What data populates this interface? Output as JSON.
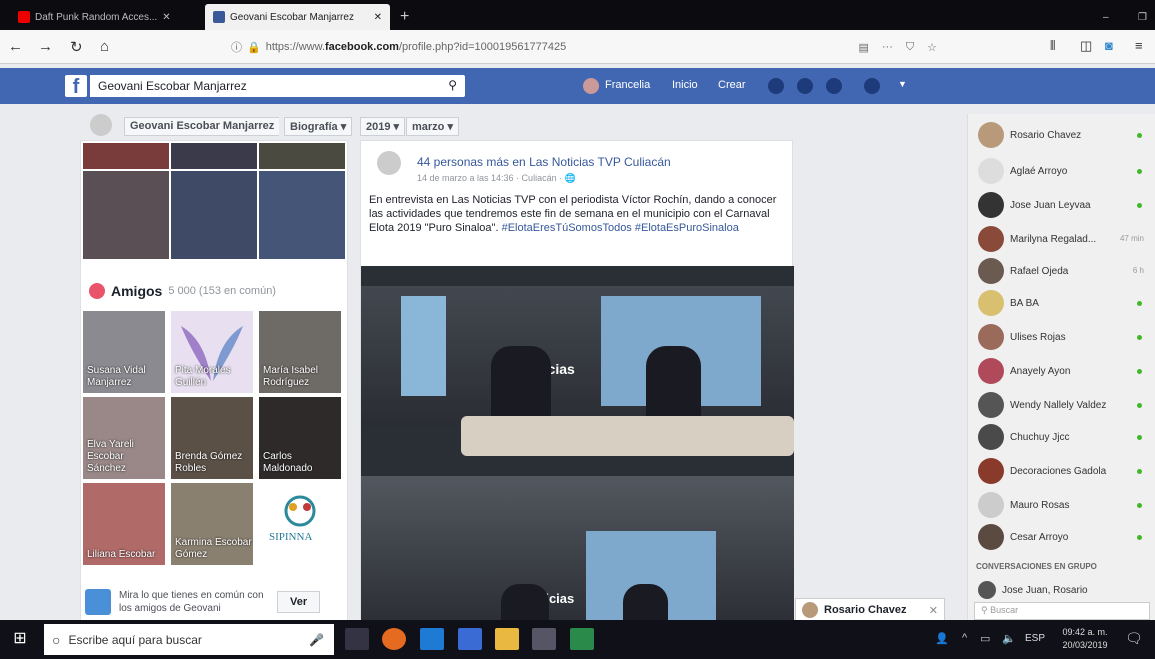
{
  "browser": {
    "tabs": [
      {
        "label": "Daft Punk Random Acces..."
      },
      {
        "label": "Geovani Escobar Manjarrez"
      }
    ],
    "url_prefix": "https://www.",
    "url_domain": "facebook.com",
    "url_path": "/profile.php?id=100019561777425"
  },
  "fb": {
    "search_value": "Geovani Escobar Manjarrez",
    "user_name": "Francelia",
    "nav_home": "Inicio",
    "nav_create": "Crear"
  },
  "timeline": {
    "name": "Geovani Escobar Manjarrez",
    "section": "Biografía",
    "year": "2019",
    "month": "marzo"
  },
  "friends": {
    "title": "Amigos",
    "count": "5 000 (153 en común)",
    "items": [
      {
        "name": "Susana Vidal Manjarrez"
      },
      {
        "name": "Pita Morales Guillén"
      },
      {
        "name": "María Isabel Rodríguez"
      },
      {
        "name": "Elva Yareli Escobar Sánchez"
      },
      {
        "name": "Brenda Gómez Robles"
      },
      {
        "name": "Carlos Maldonado"
      },
      {
        "name": "Liliana Escobar"
      },
      {
        "name": "Karmina Escobar Gómez"
      },
      {
        "name": "SIPINNA"
      }
    ],
    "common_text": "Mira lo que tienes en común con los amigos de Geovani",
    "common_button": "Ver"
  },
  "post": {
    "title": "44 personas más en Las Noticias TVP Culiacán",
    "date": "14 de marzo a las 14:36 · Culiacán ·",
    "body": "En entrevista en Las Noticias TVP con el periodista Víctor Rochín, dando a conocer las actividades que tendremos este fin de semana en el municipio con el Carnaval Elota 2019 \"Puro Sinaloa\".",
    "hashtags": "#ElotaEresTúSomosTodos #ElotaEsPuroSinaloa",
    "overlay_text": "ticias"
  },
  "chat": {
    "contacts": [
      {
        "name": "Rosario Chavez",
        "online": true
      },
      {
        "name": "Aglaé Arroyo",
        "online": true
      },
      {
        "name": "Jose Juan Leyvaa",
        "online": true
      },
      {
        "name": "Marilyna Regalad...",
        "time": "47 min"
      },
      {
        "name": "Rafael Ojeda",
        "time": "6 h"
      },
      {
        "name": "BA BA",
        "online": true
      },
      {
        "name": "Ulises Rojas",
        "online": true
      },
      {
        "name": "Anayely Ayon",
        "online": true
      },
      {
        "name": "Wendy Nallely Valdez",
        "online": true
      },
      {
        "name": "Chuchuy Jjcc",
        "online": true
      },
      {
        "name": "Decoraciones Gadola",
        "online": true
      },
      {
        "name": "Mauro Rosas",
        "online": true
      },
      {
        "name": "Cesar Arroyo",
        "online": true
      }
    ],
    "group_header": "CONVERSACIONES EN GRUPO",
    "group_item": "Jose Juan, Rosario",
    "search_placeholder": "Buscar",
    "popup_name": "Rosario Chavez"
  },
  "taskbar": {
    "search_placeholder": "Escribe aquí para buscar",
    "lang": "ESP",
    "time": "09:42 a. m.",
    "date": "20/03/2019"
  }
}
